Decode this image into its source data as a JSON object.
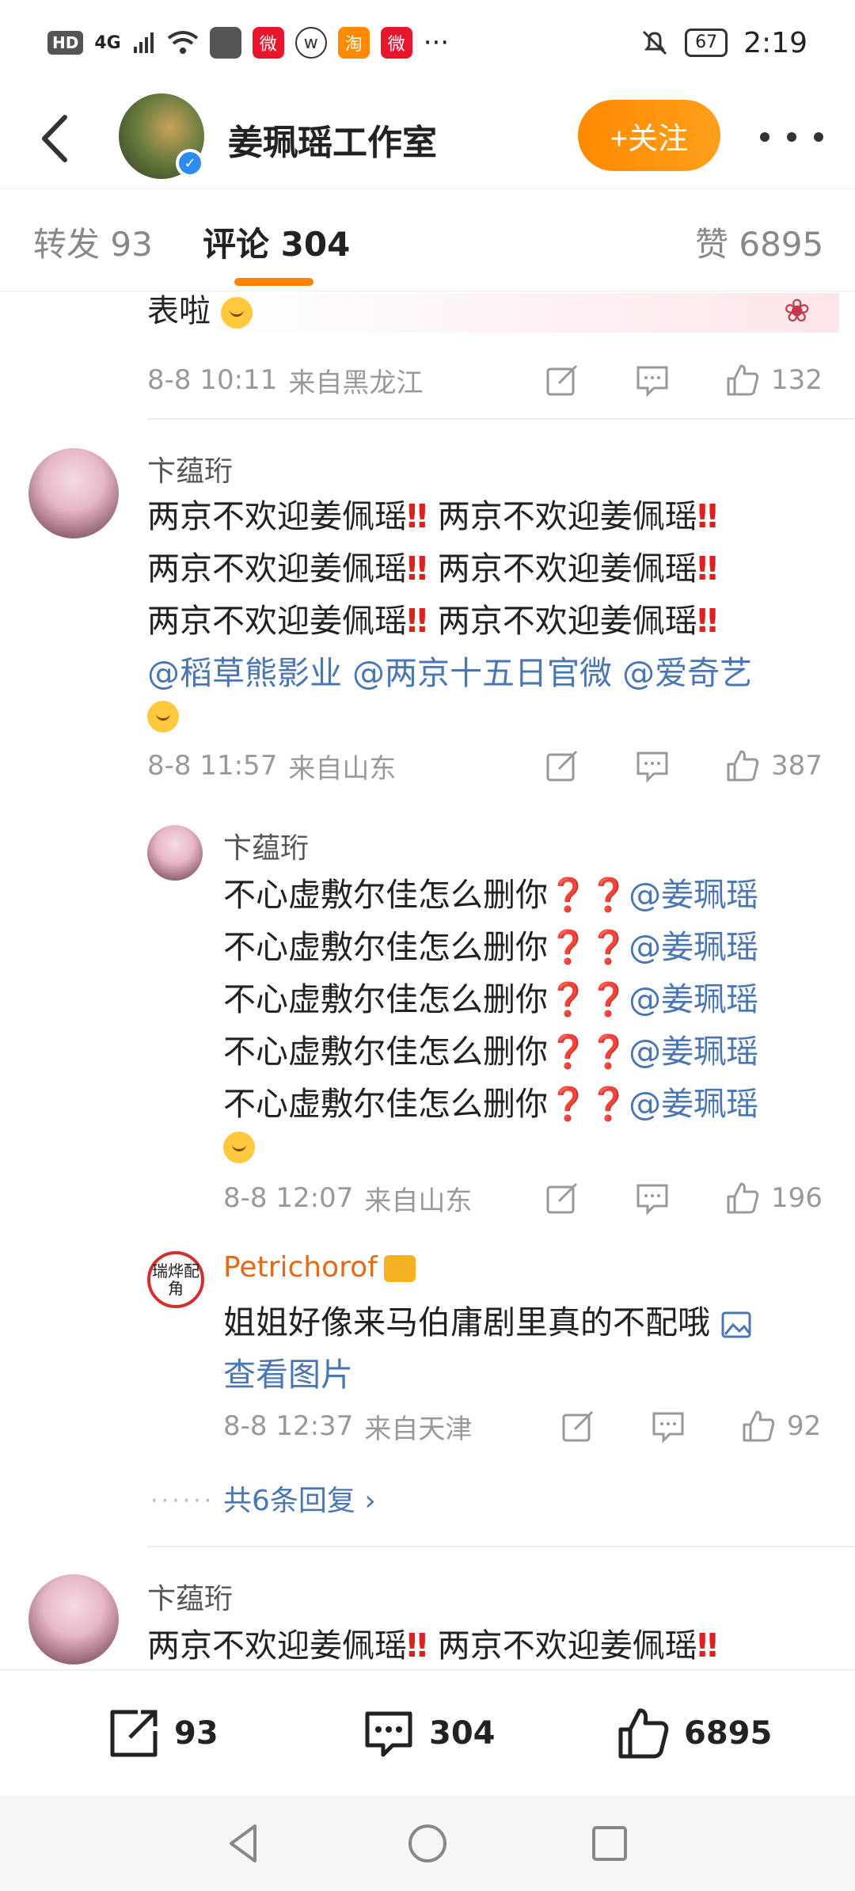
{
  "status_bar": {
    "hd": "HD",
    "network": "4G",
    "dots": "···",
    "battery": "67",
    "time": "2:19"
  },
  "header": {
    "name": "姜珮瑶工作室",
    "follow": "+关注"
  },
  "tabs": {
    "repost": "转发 93",
    "comments": "评论 304",
    "likes": "赞 6895"
  },
  "previous_comment": {
    "tail": "表啦",
    "time": "8-8 10:11",
    "location": "来自黑龙江",
    "likes": "132"
  },
  "comment1": {
    "user": "卞蕴珩",
    "lines": [
      "两京不欢迎姜佩瑶",
      "两京不欢迎姜佩瑶",
      "两京不欢迎姜佩瑶",
      "两京不欢迎姜佩瑶",
      "两京不欢迎姜佩瑶",
      "两京不欢迎姜佩瑶"
    ],
    "mentions": [
      "@稻草熊影业",
      "@两京十五日官微",
      "@爱奇艺"
    ],
    "time": "8-8 11:57",
    "location": "来自山东",
    "likes": "387"
  },
  "reply1": {
    "user": "卞蕴珩",
    "line": "不心虚敷尔佳怎么删你",
    "mention": "@姜珮瑶",
    "time": "8-8 12:07",
    "location": "来自山东",
    "likes": "196"
  },
  "reply2": {
    "user": "Petrichorof",
    "avatar_text": "瑞烨配角",
    "text": "姐姐好像来马伯庸剧里真的不配哦",
    "view_image": "查看图片",
    "time": "8-8 12:37",
    "location": "来自天津",
    "likes": "92"
  },
  "more_replies": "共6条回复 ›",
  "dots": "······",
  "comment2": {
    "user": "卞蕴珩",
    "line": "两京不欢迎姜佩瑶"
  },
  "bottom": {
    "reposts": "93",
    "comments": "304",
    "likes": "6895"
  },
  "colors": {
    "accent": "#ff8200",
    "mention": "#4a77b4",
    "exclaim": "#e02020"
  }
}
